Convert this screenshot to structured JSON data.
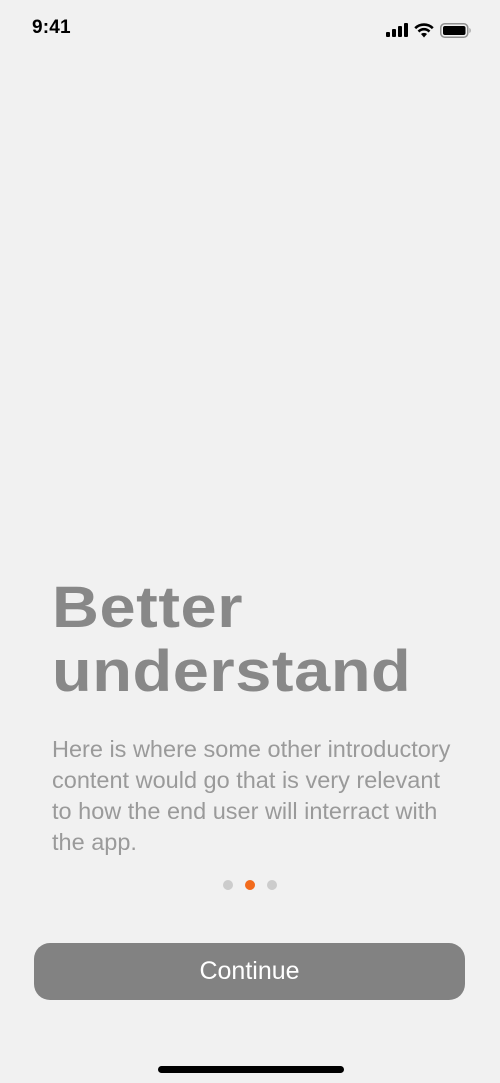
{
  "status_bar": {
    "time": "9:41",
    "icons": [
      "signal-icon",
      "wifi-icon",
      "battery-icon"
    ]
  },
  "onboarding": {
    "headline_lines": [
      "Better",
      "understand"
    ],
    "body": "Here is where some other introductory content would go that is very relevant to how the end user will interract with the app.",
    "pagination": {
      "total": 3,
      "current": 2
    },
    "continue_label": "Continue"
  },
  "colors": {
    "background": "#f1f1f1",
    "headline": "#888888",
    "body_text": "#9a9a9a",
    "dot_inactive": "#cccccc",
    "dot_active": "#f26b1d",
    "button": "#828282",
    "button_text": "#ffffff"
  }
}
